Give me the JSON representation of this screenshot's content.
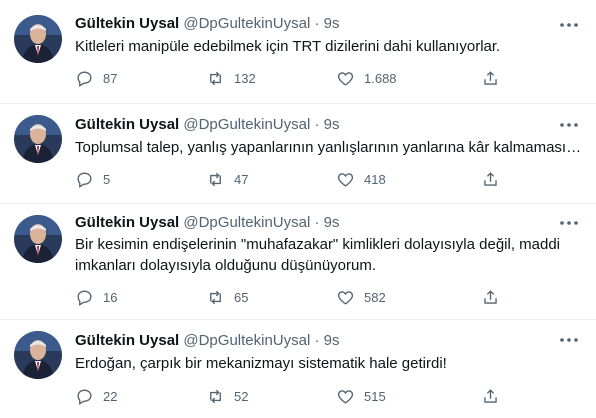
{
  "tweets": [
    {
      "name": "Gültekin Uysal",
      "handle": "@DpGultekinUysal",
      "separator": "·",
      "time": "9s",
      "text": "Kitleleri manipüle edebilmek için TRT dizilerini dahi kullanıyorlar.",
      "replies": "87",
      "retweets": "132",
      "likes": "1.688"
    },
    {
      "name": "Gültekin Uysal",
      "handle": "@DpGultekinUysal",
      "separator": "·",
      "time": "9s",
      "text": "Toplumsal talep, yanlış yapanlarının yanlışlarının yanlarına kâr kalmaması…",
      "replies": "5",
      "retweets": "47",
      "likes": "418"
    },
    {
      "name": "Gültekin Uysal",
      "handle": "@DpGultekinUysal",
      "separator": "·",
      "time": "9s",
      "text": "Bir kesimin endişelerinin \"muhafazakar\" kimlikleri dolayısıyla değil, maddi imkanları dolayısıyla olduğunu düşünüyorum.",
      "replies": "16",
      "retweets": "65",
      "likes": "582"
    },
    {
      "name": "Gültekin Uysal",
      "handle": "@DpGultekinUysal",
      "separator": "·",
      "time": "9s",
      "text": "Erdoğan, çarpık bir mekanizmayı sistematik hale getirdi!",
      "replies": "22",
      "retweets": "52",
      "likes": "515"
    }
  ],
  "icons": {
    "more": "more-horizontal-icon",
    "reply": "reply-icon",
    "retweet": "retweet-icon",
    "like": "heart-icon",
    "share": "share-icon"
  },
  "colors": {
    "text": "#0f1419",
    "secondary": "#536471",
    "divider": "#eff3f4"
  }
}
